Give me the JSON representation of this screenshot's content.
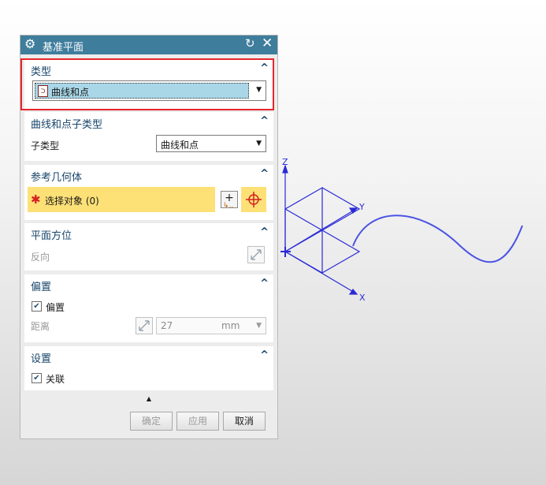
{
  "dialog": {
    "title": "基准平面",
    "icons": {
      "title": "gear-icon",
      "reset": "reset-icon",
      "close": "close-icon"
    }
  },
  "sections": {
    "type": {
      "title": "类型",
      "selected": "曲线和点",
      "icon": "curve-point-icon"
    },
    "subtype": {
      "title": "曲线和点子类型",
      "label": "子类型",
      "selected": "曲线和点"
    },
    "reference": {
      "title": "参考几何体",
      "select_label": "选择对象 (0)",
      "required_mark": "✱",
      "icons": [
        "add-point-icon",
        "crosshair-icon"
      ]
    },
    "orientation": {
      "title": "平面方位",
      "reverse_label": "反向",
      "icon": "reverse-arrows-icon"
    },
    "offset": {
      "title": "偏置",
      "checkbox_label": "偏置",
      "checked": true,
      "distance_label": "距离",
      "distance_value": "27",
      "unit": "mm"
    },
    "settings": {
      "title": "设置",
      "checkbox_label": "关联",
      "checked": true
    }
  },
  "buttons": {
    "ok": "确定",
    "apply": "应用",
    "cancel": "取消"
  },
  "viewport": {
    "axis_labels": {
      "z": "Z",
      "y": "Y",
      "x": "X"
    },
    "curve_color": "#4b54e3",
    "axis_color": "#2a2ad6"
  },
  "colors": {
    "title_bar": "#3f7d9c",
    "section_title": "#17456b",
    "selection_yellow": "#fde076",
    "highlight_red": "#e8262b",
    "selected_item": "#a9d7e8"
  }
}
